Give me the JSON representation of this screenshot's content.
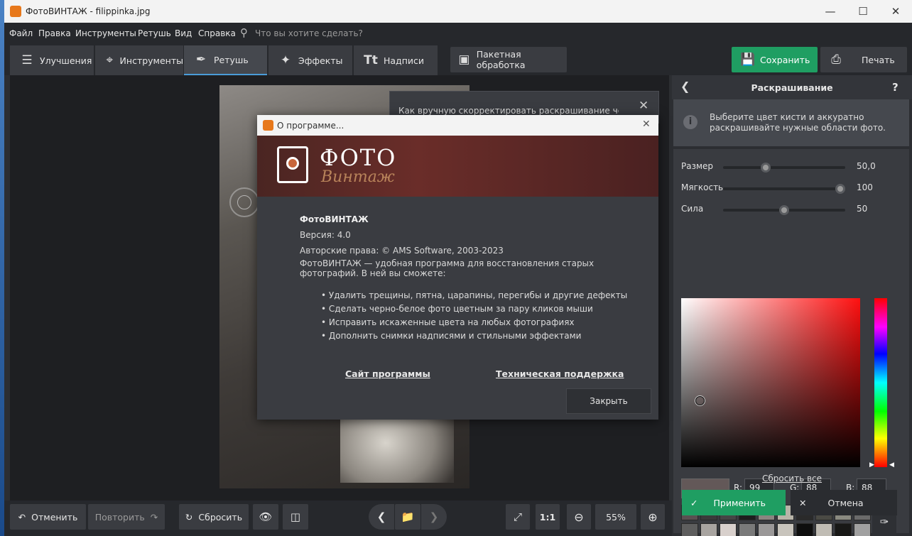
{
  "window": {
    "title": "ФотоВИНТАЖ - filippinka.jpg"
  },
  "menu": {
    "items": [
      "Файл",
      "Правка",
      "Инструменты",
      "Ретушь",
      "Вид",
      "Справка"
    ],
    "search_placeholder": "Что вы хотите сделать?"
  },
  "tabs": [
    {
      "label": "Улучшения",
      "icon": "sliders-icon"
    },
    {
      "label": "Инструменты",
      "icon": "crop-icon"
    },
    {
      "label": "Ретушь",
      "icon": "brush-icon",
      "active": true
    },
    {
      "label": "Эффекты",
      "icon": "wand-icon"
    },
    {
      "label": "Надписи",
      "icon": "text-icon"
    }
  ],
  "batch": {
    "label": "Пакетная обработка"
  },
  "save": {
    "label": "Сохранить"
  },
  "print": {
    "label": "Печать"
  },
  "tip": {
    "text": "Как вручную скорректировать раскрашивание чёрно-"
  },
  "about": {
    "title": "О программе...",
    "logo_line1": "ФОТО",
    "logo_line2": "Винтаж",
    "app_name": "ФотоВИНТАЖ",
    "version": "Версия: 4.0",
    "copyright": "Авторские права: © AMS Software, 2003-2023",
    "desc_line1": "ФотоВИНТАЖ — удобная программа для восстановления старых",
    "desc_line2": "фотографий. В ней вы сможете:",
    "bullets": [
      "• Удалить трещины, пятна, царапины, перегибы и другие дефекты",
      "• Сделать черно-белое фото цветным за пару кликов мыши",
      "• Исправить искаженные цвета на любых фотографиях",
      "• Дополнить снимки надписями и стильными эффектами"
    ],
    "site_link": "Сайт программы",
    "support_link": "Техническая поддержка",
    "close_button": "Закрыть"
  },
  "panel": {
    "title": "Раскрашивание",
    "help": "?",
    "info_line1": "Выберите цвет кисти и аккуратно",
    "info_line2": "раскрашивайте нужные области фото.",
    "sliders": [
      {
        "label": "Размер",
        "value": "50,0",
        "fraction": 0.35
      },
      {
        "label": "Мягкость",
        "value": "100",
        "fraction": 0.96
      },
      {
        "label": "Сила",
        "value": "50",
        "fraction": 0.5
      }
    ],
    "rgb": {
      "r_label": "R:",
      "r": "99",
      "g_label": "G:",
      "g": "88",
      "b_label": "B:",
      "b": "88"
    },
    "current_color": "#635858",
    "swatches_row1": [
      "#5a5051",
      "#3a3a3a",
      "#454545",
      "#1e1e1e",
      "#8a8580",
      "#b8b4a8",
      "#2a2a2a",
      "#4a4a44",
      "#8a8a80",
      "#6a6a6a"
    ],
    "swatches_row2": [
      "#5e5e5e",
      "#a8a4a0",
      "#d8d0cc",
      "#7a7a7a",
      "#9a9898",
      "#c8c4bc",
      "#0e0e0e",
      "#c0bcb4",
      "#181816",
      "#a0a0a0"
    ],
    "reset_all": "Сбросить все",
    "apply": "Применить",
    "cancel": "Отмена"
  },
  "bottom": {
    "undo": "Отменить",
    "redo": "Повторить",
    "reset": "Сбросить",
    "ratio": "1:1",
    "zoom": "55%"
  },
  "colors": {
    "accent_green": "#1f9e62",
    "active_tab_line": "#4a9cd8"
  }
}
